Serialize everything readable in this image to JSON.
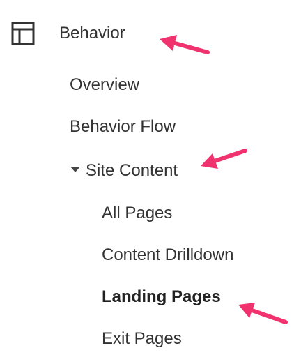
{
  "nav": {
    "section": {
      "icon": "layout-icon",
      "label": "Behavior"
    },
    "items": [
      {
        "label": "Overview"
      },
      {
        "label": "Behavior Flow"
      },
      {
        "label": "Site Content",
        "expanded": true
      }
    ],
    "subitems": [
      {
        "label": "All Pages"
      },
      {
        "label": "Content Drilldown"
      },
      {
        "label": "Landing Pages",
        "selected": true
      },
      {
        "label": "Exit Pages"
      }
    ]
  },
  "annotations": {
    "arrow_color": "#f0336e",
    "arrow_icon": "arrow-pointer-icon"
  }
}
